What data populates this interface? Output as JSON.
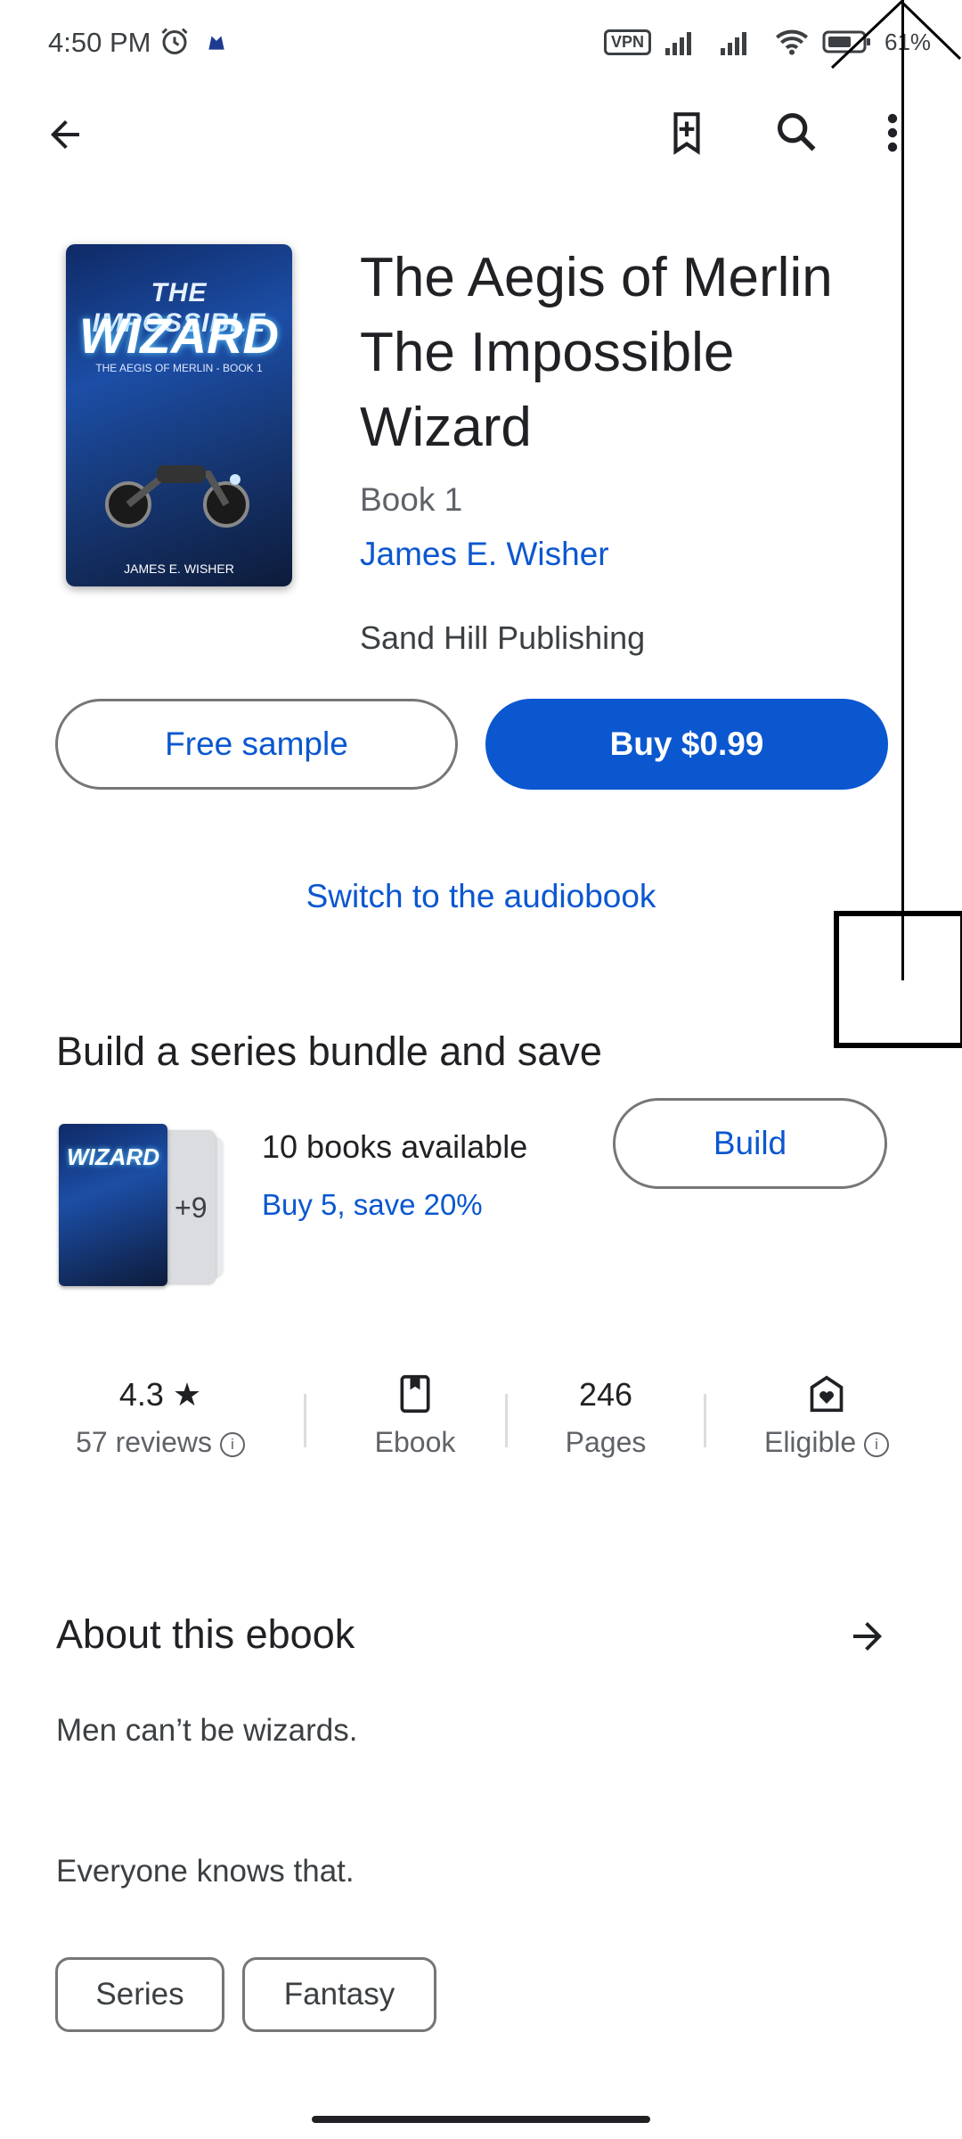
{
  "status_bar": {
    "time": "4:50 PM",
    "vpn": "VPN",
    "battery": "61%"
  },
  "app_bar": {
    "back_icon": "arrow-left-icon",
    "wishlist_icon": "bookmark-add-icon",
    "search_icon": "search-icon",
    "more_icon": "more-vert-icon"
  },
  "book": {
    "cover_title_line1": "THE IMPOSSIBLE",
    "cover_title_line2": "WIZARD",
    "cover_subtitle": "THE AEGIS OF MERLIN - BOOK 1",
    "cover_author": "JAMES E. WISHER",
    "title": "The Aegis of Merlin The Impossible Wizard",
    "series_number": "Book 1",
    "author": "James E. Wisher",
    "publisher": "Sand Hill Publishing"
  },
  "actions": {
    "free_sample": "Free sample",
    "buy": "Buy $0.99",
    "switch_audiobook": "Switch to the audiobook"
  },
  "bundle": {
    "heading": "Build a series bundle and save",
    "plus_count": "+9",
    "cover_text": "WIZARD",
    "available": "10 books available",
    "offer": "Buy 5, save 20%",
    "build_button": "Build"
  },
  "stats": {
    "rating": "4.3",
    "reviews": "57 reviews",
    "format": "Ebook",
    "pages_value": "246",
    "pages_label": "Pages",
    "eligible": "Eligible"
  },
  "about": {
    "heading": "About this ebook",
    "paragraph1": "Men can’t be wizards.",
    "paragraph2": "Everyone knows that."
  },
  "tags": [
    "Series",
    "Fantasy"
  ],
  "colors": {
    "accent": "#0b57d0",
    "outline": "#747775",
    "text": "#202124"
  }
}
